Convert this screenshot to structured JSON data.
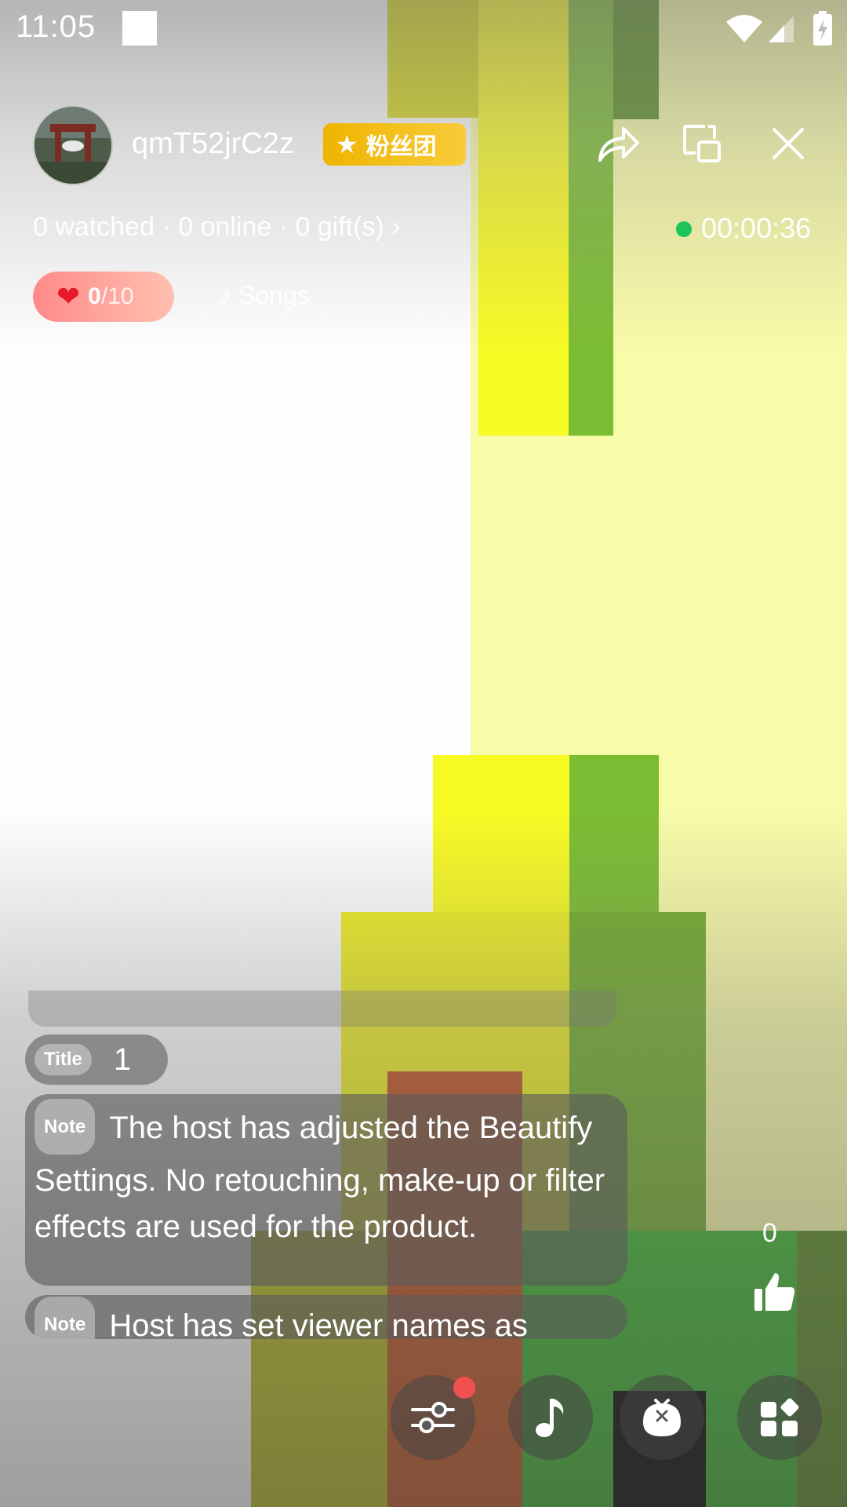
{
  "status_bar": {
    "time": "11:05"
  },
  "header": {
    "username": "qmT52jrC2z",
    "fan_badge": "粉丝团",
    "stats": "0 watched · 0 online · 0 gift(s) ›",
    "timer": "00:00:36"
  },
  "hearts": {
    "current": "0",
    "total": "/10"
  },
  "songs_label": "Songs",
  "chat": {
    "title_tag": "Title",
    "title_value": "1",
    "messages": [
      {
        "tag": "Note",
        "text": "The host has adjusted the Beautify Settings. No retouching, make-up or filter effects are used for the product."
      },
      {
        "tag": "Note",
        "text": "Host has set viewer names as"
      }
    ]
  },
  "likes": {
    "count": "0"
  },
  "colors": {
    "live_dot": "#1dc45a",
    "badge": "#f0b400",
    "heart": "#e8192c",
    "notification_dot": "#f05050"
  },
  "icons": [
    "share-icon",
    "window-icon",
    "close-icon",
    "sliders-icon",
    "music-note-icon",
    "bag-icon",
    "grid-icon",
    "thumbs-up-icon"
  ]
}
